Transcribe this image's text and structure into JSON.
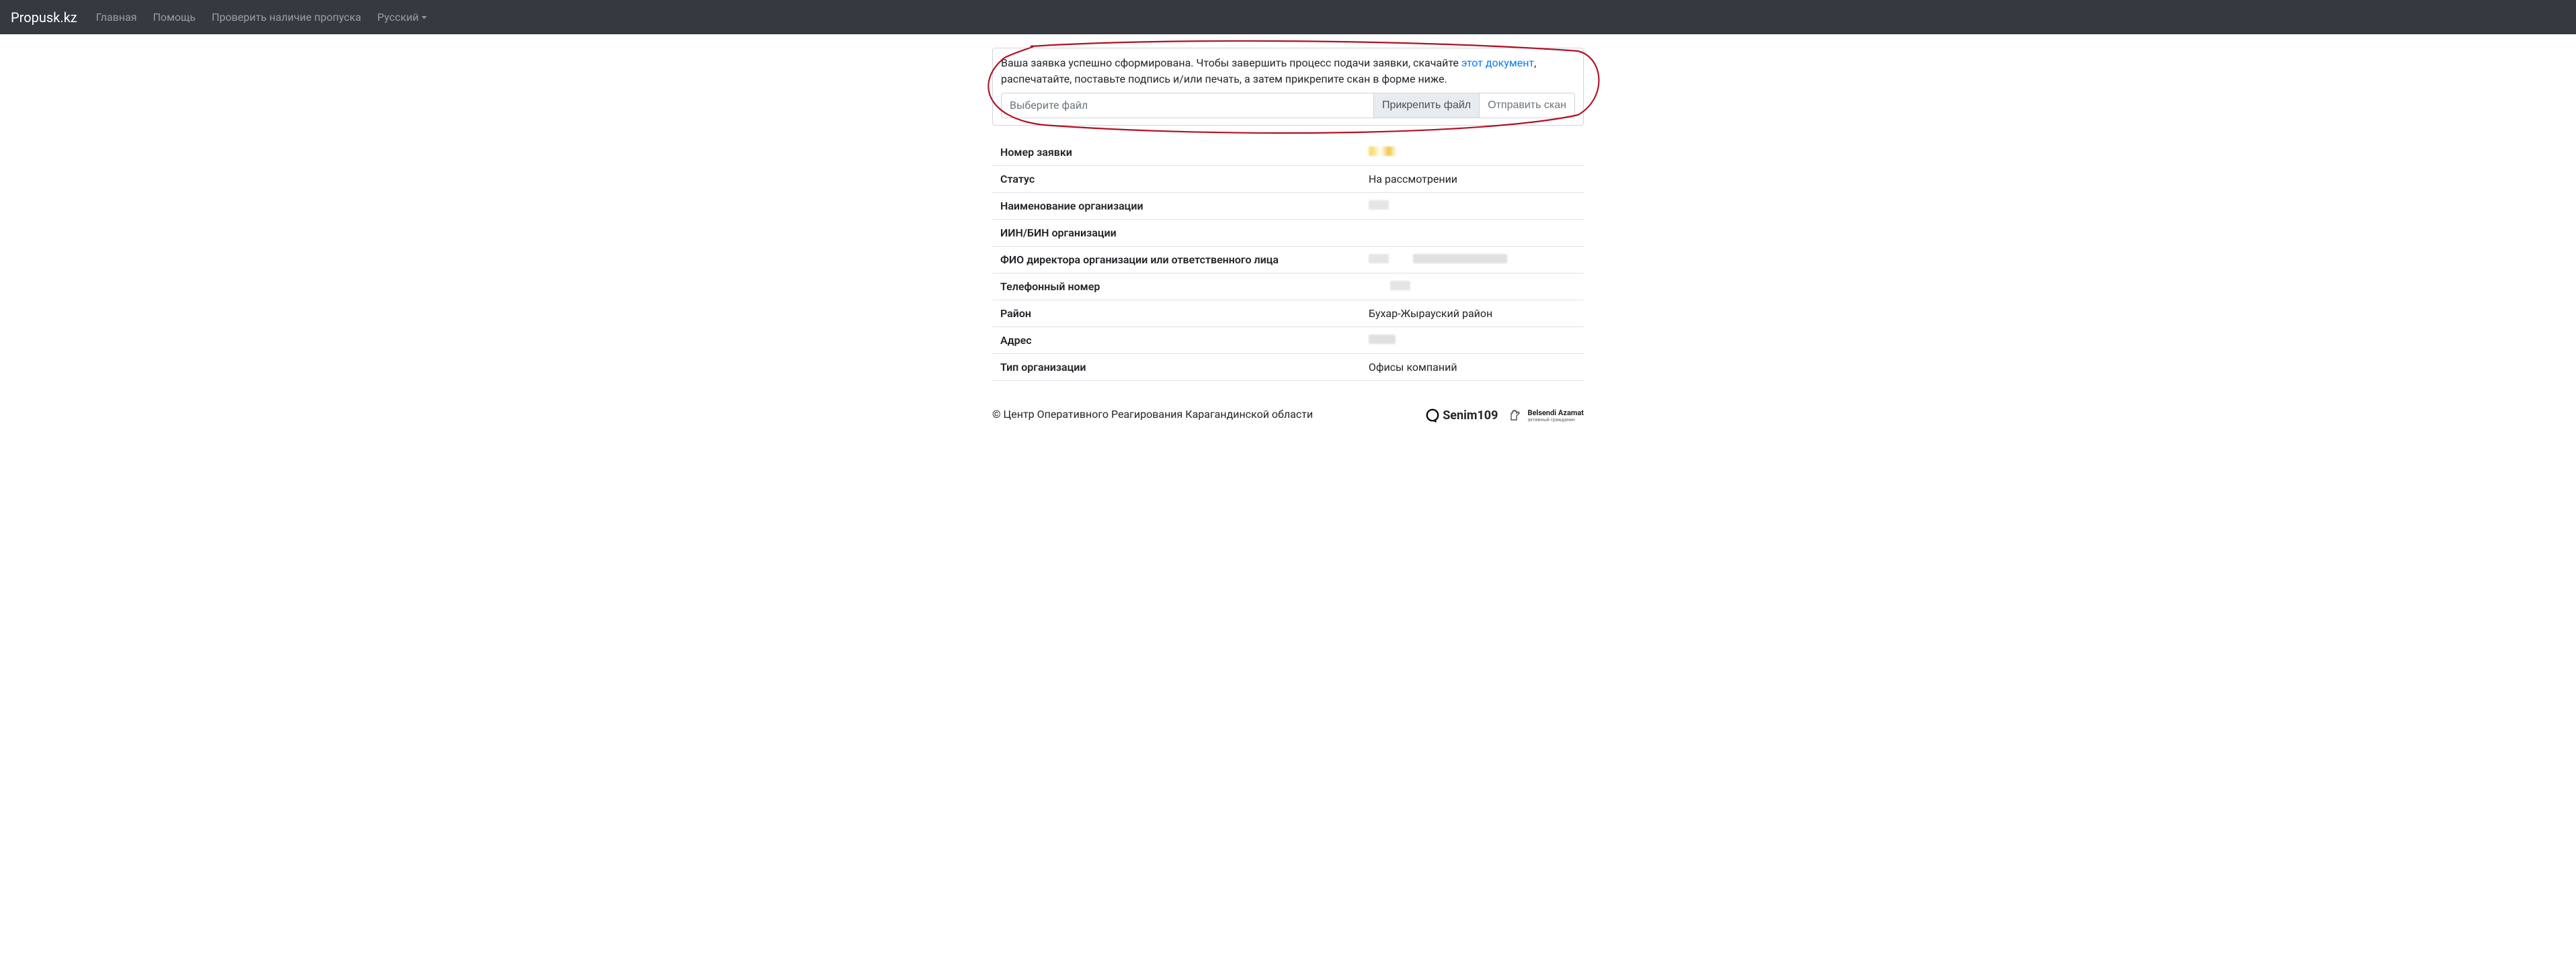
{
  "navbar": {
    "brand": "Propusk.kz",
    "links": {
      "home": "Главная",
      "help": "Помощь",
      "check": "Проверить наличие пропуска",
      "lang": "Русский"
    }
  },
  "alert": {
    "text_before": "Ваша заявка успешно сформирована. Чтобы завершить процесс подачи заявки, скачайте ",
    "link": "этот документ",
    "text_after": ", распечатайте, поставьте подпись и/или печать, а затем прикрепите скан в форме ниже."
  },
  "upload": {
    "placeholder": "Выберите файл",
    "attach_btn": "Прикрепить файл",
    "send_btn": "Отправить скан"
  },
  "rows": [
    {
      "label": "Номер заявки",
      "value": ""
    },
    {
      "label": "Статус",
      "value": "На рассмотрении"
    },
    {
      "label": "Наименование организации",
      "value": ""
    },
    {
      "label": "ИИН/БИН организации",
      "value": ""
    },
    {
      "label": "ФИО директора организации или ответственного лица",
      "value": ""
    },
    {
      "label": "Телефонный номер",
      "value": ""
    },
    {
      "label": "Район",
      "value": "Бухар-Жырауский район"
    },
    {
      "label": "Адрес",
      "value": ""
    },
    {
      "label": "Тип организации",
      "value": "Офисы компаний"
    }
  ],
  "footer": {
    "copyright": "© Центр Оперативного Реагирования Карагандинской области",
    "logo_senim": "Senim109",
    "logo_belsendi": "Belsendi Azamat",
    "logo_belsendi_sub": "активный гражданин"
  },
  "colors": {
    "annotation": "#b01225"
  }
}
